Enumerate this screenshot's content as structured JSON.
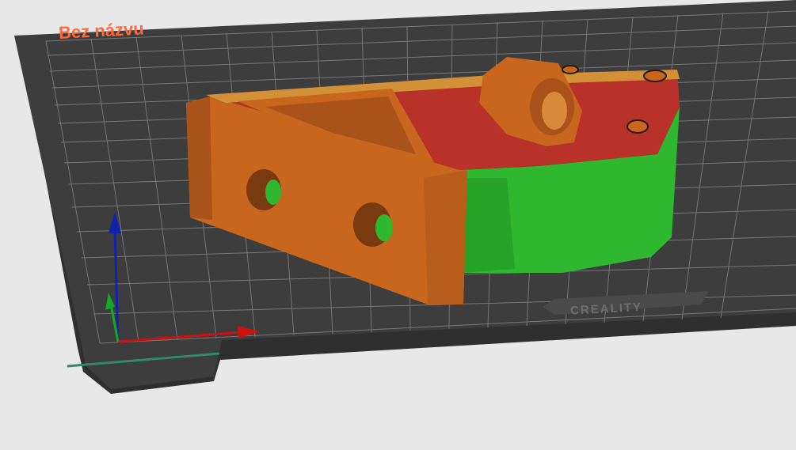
{
  "plate": {
    "name": "Bez názvu",
    "brand": "CREALITY"
  },
  "colors": {
    "background": "#e8e8e8",
    "bed": "#3d3d3d",
    "bed_edge": "#2b2b2b",
    "grid": "#8a8a8a",
    "plate_label": "#ff6a3d",
    "brand": "#6e6e6e",
    "wall_orange": "#c8661e",
    "wall_orange_dark": "#a9521a",
    "top_red": "#b8322a",
    "support_green": "#2fb82f",
    "support_green_dark": "#239623",
    "axis_x": "#cc1111",
    "axis_y": "#11aa22",
    "axis_z": "#1122aa"
  },
  "icons": [
    "axis-x-arrow-icon",
    "axis-y-arrow-icon",
    "axis-z-arrow-icon"
  ]
}
